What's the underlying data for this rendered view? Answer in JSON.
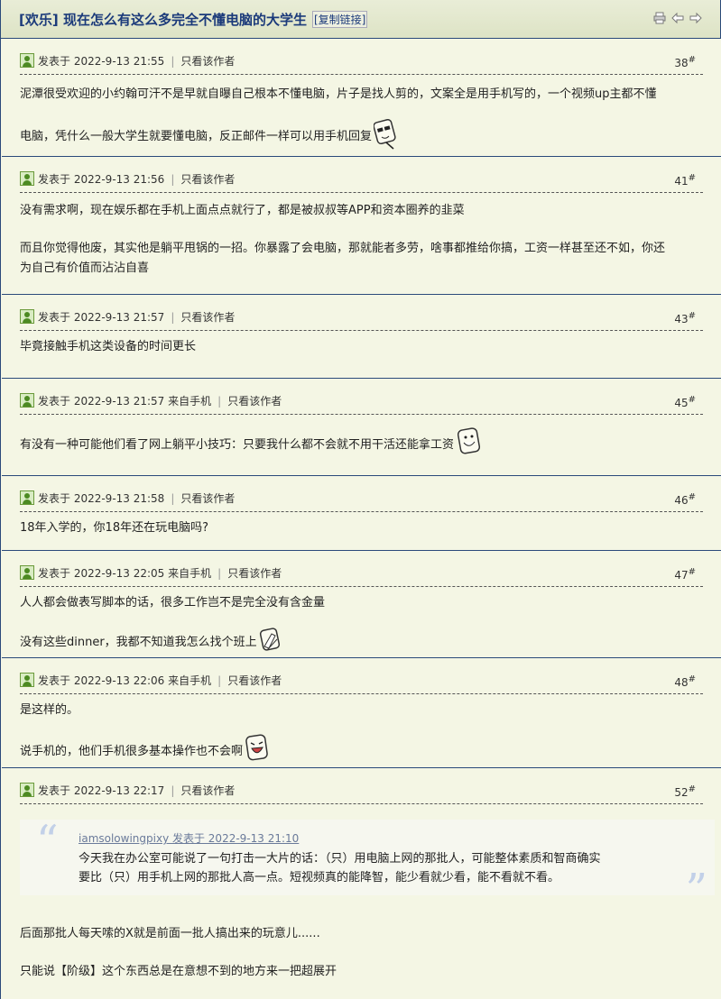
{
  "thread": {
    "tag": "[欢乐]",
    "title": "现在怎么有这么多完全不懂电脑的大学生",
    "copy_link": "[复制链接]",
    "icons": [
      "print-icon",
      "prev-icon",
      "next-icon"
    ]
  },
  "labels": {
    "only_author": "只看该作者"
  },
  "posts": [
    {
      "posted": "发表于 2022-9-13 21:55",
      "floor": "38",
      "lines": [
        "泥潭很受欢迎的小约翰可汗不是早就自曝自己根本不懂电脑，片子是找人剪的，文案全是用手机写的，一个视频up主都不懂",
        "电脑，凭什么一般大学生就要懂电脑，反正邮件一样可以用手机回复"
      ]
    },
    {
      "posted": "发表于 2022-9-13 21:56",
      "floor": "41",
      "lines": [
        "没有需求啊，现在娱乐都在手机上面点点就行了，都是被叔叔等APP和资本圈养的韭菜",
        "而且你觉得他废，其实他是躺平甩锅的一招。你暴露了会电脑，那就能者多劳，啥事都推给你搞，工资一样甚至还不如，你还",
        "为自己有价值而沾沾自喜"
      ]
    },
    {
      "posted": "发表于 2022-9-13 21:57",
      "floor": "43",
      "lines": [
        "毕竟接触手机这类设备的时间更长"
      ]
    },
    {
      "posted": "发表于 2022-9-13 21:57 来自手机",
      "floor": "45",
      "lines": [
        "有没有一种可能他们看了网上躺平小技巧：只要我什么都不会就不用干活还能拿工资"
      ]
    },
    {
      "posted": "发表于 2022-9-13 21:58",
      "floor": "46",
      "lines": [
        "18年入学的，你18年还在玩电脑吗?"
      ]
    },
    {
      "posted": "发表于 2022-9-13 22:05 来自手机",
      "floor": "47",
      "lines": [
        "人人都会做表写脚本的话，很多工作岂不是完全没有含金量",
        "没有这些dinner，我都不知道我怎么找个班上"
      ]
    },
    {
      "posted": "发表于 2022-9-13 22:06 来自手机",
      "floor": "48",
      "lines": [
        "是这样的。",
        "说手机的，他们手机很多基本操作也不会啊"
      ]
    },
    {
      "posted": "发表于 2022-9-13 22:17",
      "floor": "52",
      "quote": {
        "author": "iamsolowingpixy 发表于 2022-9-13 21:10",
        "lines": [
          "今天我在办公室可能说了一句打击一大片的话：（只）用电脑上网的那批人，可能整体素质和智商确实",
          "要比（只）用手机上网的那批人高一点。短视频真的能降智，能少看就少看，能不看就不看。"
        ]
      },
      "lines": [
        "后面那批人每天嗦的X就是前面一批人搞出来的玩意儿......",
        "只能说【阶级】这个东西总是在意想不到的地方来一把超展开"
      ]
    }
  ]
}
